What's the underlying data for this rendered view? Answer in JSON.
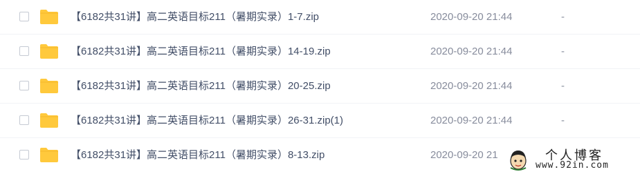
{
  "files": [
    {
      "name": "【6182共31讲】高二英语目标211（暑期实录）1-7.zip",
      "date": "2020-09-20 21:44",
      "size": "-"
    },
    {
      "name": "【6182共31讲】高二英语目标211（暑期实录）14-19.zip",
      "date": "2020-09-20 21:44",
      "size": "-"
    },
    {
      "name": "【6182共31讲】高二英语目标211（暑期实录）20-25.zip",
      "date": "2020-09-20 21:44",
      "size": "-"
    },
    {
      "name": "【6182共31讲】高二英语目标211（暑期实录）26-31.zip(1)",
      "date": "2020-09-20 21:44",
      "size": "-"
    },
    {
      "name": "【6182共31讲】高二英语目标211（暑期实录）8-13.zip",
      "date": "2020-09-20 21",
      "size": ""
    }
  ],
  "watermark": {
    "title": "个人博客",
    "url": "www.92in.com"
  },
  "colors": {
    "folder": "#ffc93c",
    "folder_dark": "#f5b82a",
    "text": "#424e67",
    "muted": "#878c9c"
  }
}
